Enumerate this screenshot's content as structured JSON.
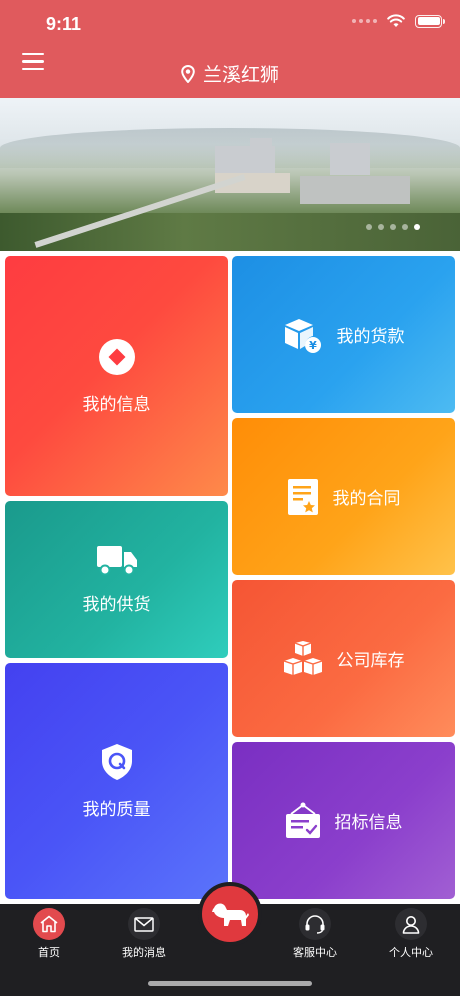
{
  "status": {
    "time": "9:11"
  },
  "header": {
    "menu_icon": "menu-icon",
    "location_icon": "location-pin-icon",
    "location": "兰溪红狮"
  },
  "banner": {
    "slides": 5,
    "active_slide": 4
  },
  "tiles": {
    "info": {
      "label": "我的信息",
      "icon": "diamond-badge-icon"
    },
    "payment": {
      "label": "我的货款",
      "icon": "box-yen-icon"
    },
    "contract": {
      "label": "我的合同",
      "icon": "contract-star-icon"
    },
    "supply": {
      "label": "我的供货",
      "icon": "truck-icon"
    },
    "stock": {
      "label": "公司库存",
      "icon": "boxes-icon"
    },
    "quality": {
      "label": "我的质量",
      "icon": "shield-q-icon"
    },
    "bid": {
      "label": "招标信息",
      "icon": "bid-sign-icon"
    }
  },
  "tabbar": {
    "home": "首页",
    "messages": "我的消息",
    "center_icon": "lion-icon",
    "service": "客服中心",
    "profile": "个人中心",
    "colors": {
      "active": "#e24a4e",
      "bg": "#1f1f22"
    }
  },
  "colors": {
    "brand": "#e05a5d"
  }
}
